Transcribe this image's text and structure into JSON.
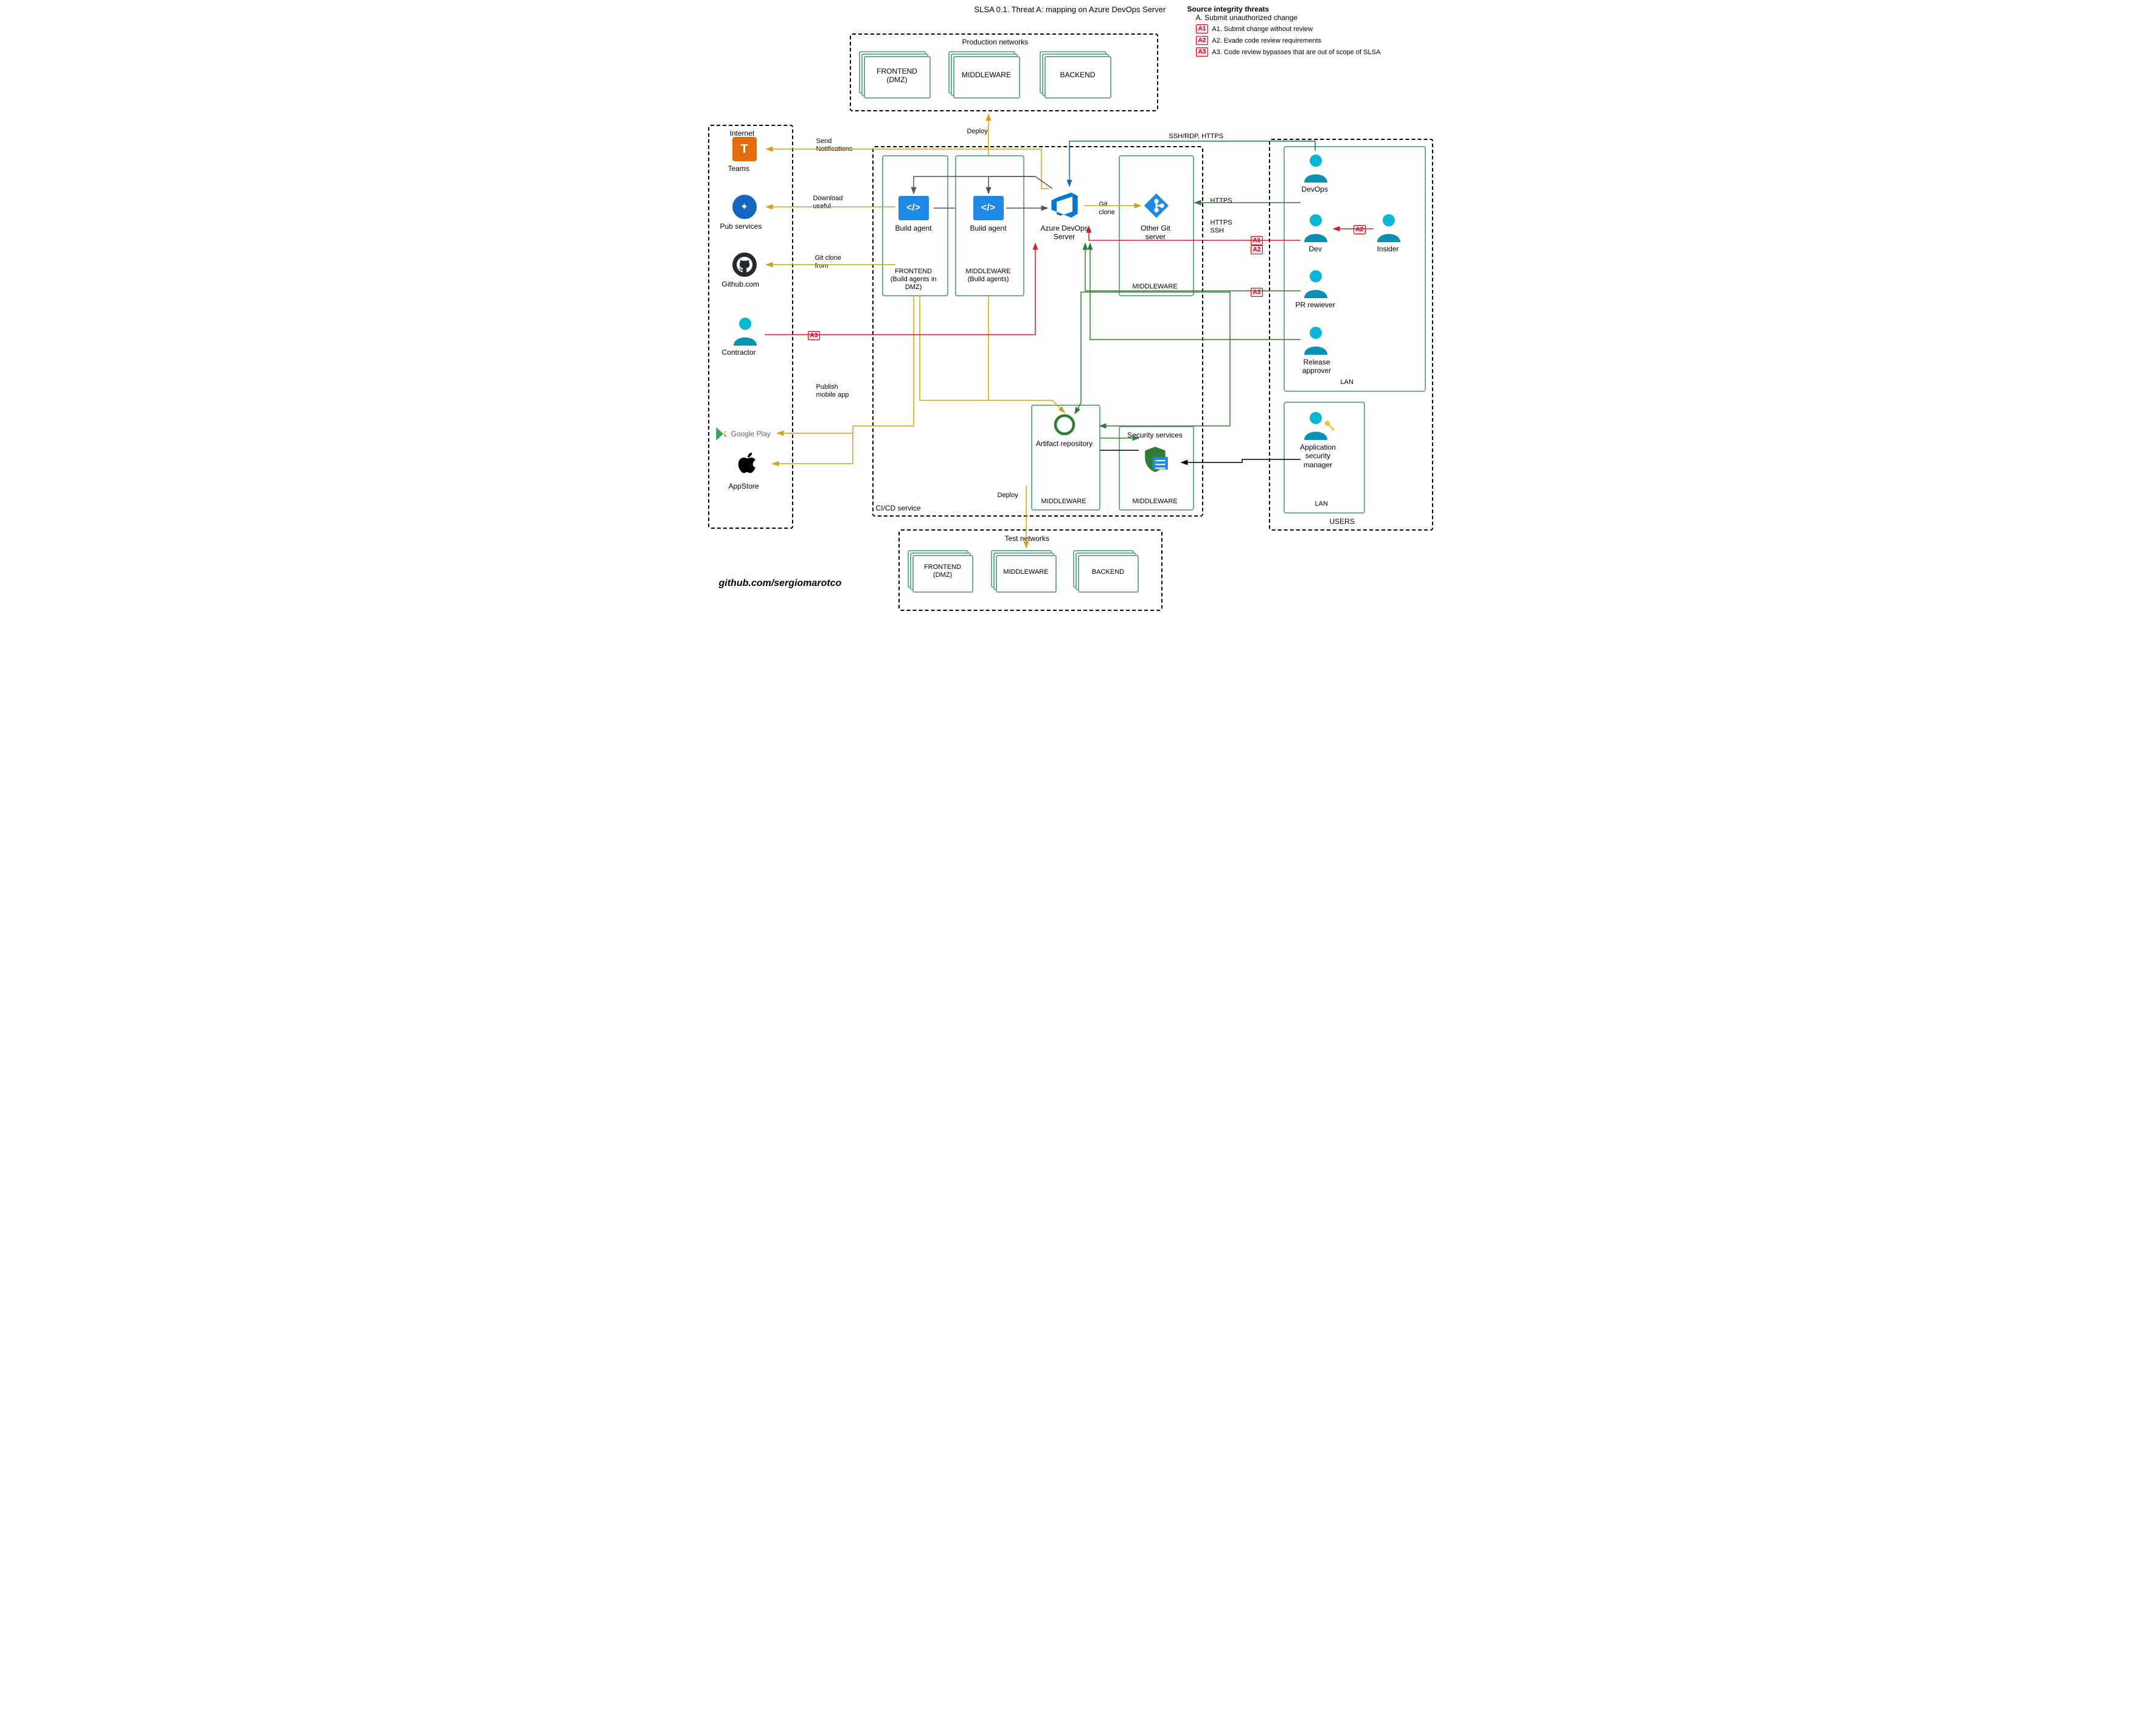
{
  "title": "SLSA 0.1. Threat A: mapping on Azure DevOps Server",
  "attribution": "github.com/sergiomarotco",
  "legend": {
    "heading": "Source integrity threats",
    "sub": "A. Submit unauthorized change",
    "items": [
      {
        "badge": "A1",
        "text": "A1. Submit change without review"
      },
      {
        "badge": "A2",
        "text": "A2. Evade code review requirements"
      },
      {
        "badge": "A3",
        "text": "A3. Code review bypasses that are out of scope of SLSA"
      }
    ]
  },
  "zones": {
    "prod": "Production networks",
    "test": "Test networks",
    "internet": "Internet",
    "cicd": "CI/CD service",
    "users": "USERS",
    "lan": "LAN",
    "lan2": "LAN"
  },
  "tiers": {
    "frontend_dmz": "FRONTEND\n(DMZ)",
    "middleware": "MIDDLEWARE",
    "backend": "BACKEND",
    "frontend_build": "FRONTEND\n(Build agents in DMZ)",
    "middleware_build": "MIDDLEWARE\n(Build agents)"
  },
  "nodes": {
    "teams": "Teams",
    "pub": "Pub services",
    "github": "Github.com",
    "contractor": "Contractor",
    "gplay": "Google Play",
    "appstore": "AppStore",
    "build_agent": "Build agent",
    "azdo": "Azure DevOps Server",
    "othergit": "Other Git server",
    "artifact": "Artifact repository",
    "security": "Security services",
    "devops": "DevOps",
    "dev": "Dev",
    "insider": "Insider",
    "prrev": "PR rewiever",
    "release": "Release approver",
    "appsec": "Application security manager"
  },
  "edge_labels": {
    "send_notif": "Send\nNotifications",
    "download": "Download\nuseful",
    "gitclone_from": "Git clone\nfrom",
    "publish": "Publish\nmobile app",
    "deploy_up": "Deploy",
    "deploy_down": "Deploy",
    "sshrdp": "SSH/RDP, HTTPS",
    "https": "HTTPS",
    "https_ssh": "HTTPS\nSSH",
    "gitclone": "Git\nclone"
  },
  "badges": {
    "a1": "A1",
    "a2": "A2",
    "a3": "A3"
  },
  "colors": {
    "yellow": "#d4a017",
    "green": "#2e7d32",
    "red": "#c1272d",
    "gray": "#555",
    "blue": "#1565c0",
    "black": "#000"
  }
}
